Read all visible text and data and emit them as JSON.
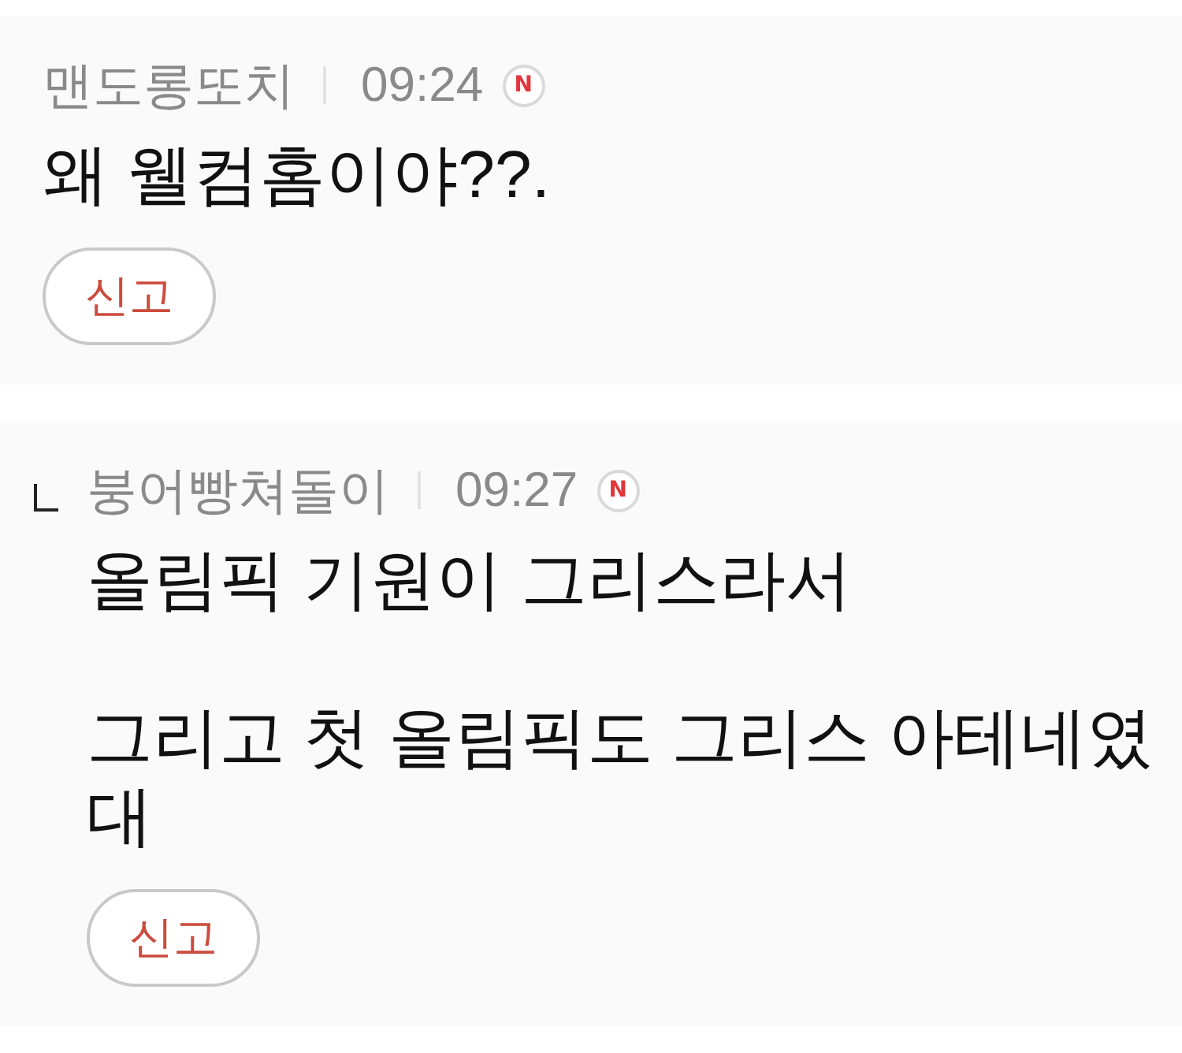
{
  "comments": [
    {
      "kind": "comment",
      "author": "맨도롱또치",
      "time": "09:24",
      "new_badge": "N",
      "paragraphs": [
        "왜 웰컴홈이야??."
      ],
      "report_button": "신고"
    },
    {
      "kind": "reply",
      "author": "붕어빵쳐돌이",
      "time": "09:27",
      "new_badge": "N",
      "paragraphs": [
        "올림픽 기원이 그리스라서",
        "그리고 첫 올림픽도 그리스 아테네였대"
      ],
      "report_button": "신고"
    }
  ]
}
